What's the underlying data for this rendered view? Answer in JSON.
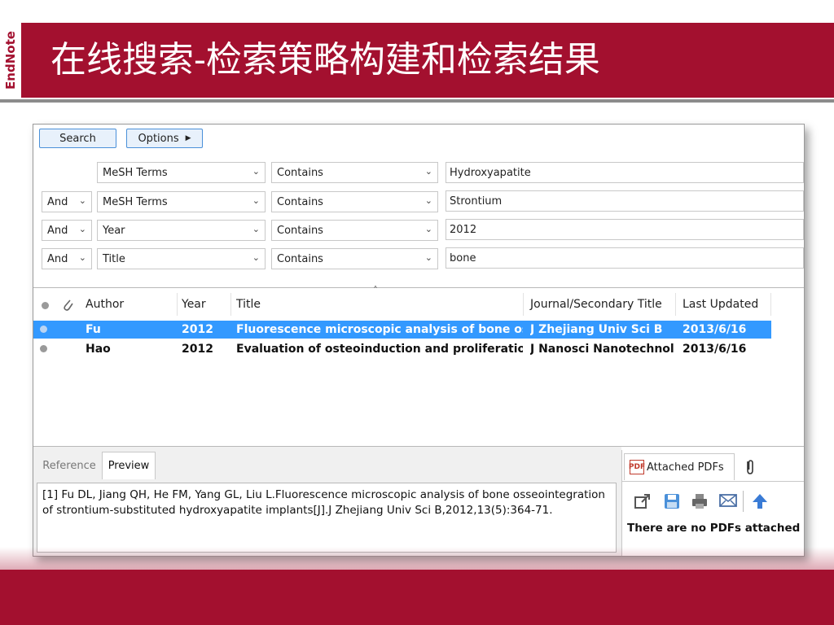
{
  "slide": {
    "logo": "EndNote",
    "title": "在线搜索-检索策略构建和检索结果"
  },
  "toolbar": {
    "search_label": "Search",
    "options_label": "Options",
    "options_arrow": "▶"
  },
  "search_rows": [
    {
      "bool": "",
      "field": "MeSH Terms",
      "operator": "Contains",
      "value": "Hydroxyapatite"
    },
    {
      "bool": "And",
      "field": "MeSH Terms",
      "operator": "Contains",
      "value": "Strontium"
    },
    {
      "bool": "And",
      "field": "Year",
      "operator": "Contains",
      "value": "2012"
    },
    {
      "bool": "And",
      "field": "Title",
      "operator": "Contains",
      "value": "bone"
    }
  ],
  "columns": {
    "author": "Author",
    "year": "Year",
    "title": "Title",
    "journal": "Journal/Secondary Title",
    "updated": "Last Updated",
    "sort_arrow": "˄"
  },
  "results": [
    {
      "author": "Fu",
      "year": "2012",
      "title": "Fluorescence microscopic analysis of bone osse...",
      "journal": "J Zhejiang Univ Sci B",
      "updated": "2013/6/16",
      "selected": true
    },
    {
      "author": "Hao",
      "year": "2012",
      "title": "Evaluation of osteoinduction and proliferation ...",
      "journal": "J Nanosci Nanotechnol",
      "updated": "2013/6/16",
      "selected": false
    }
  ],
  "panel_tabs": {
    "reference": "Reference",
    "preview": "Preview",
    "attached_pdfs": "Attached PDFs"
  },
  "preview_text": "[1] Fu DL, Jiang QH, He FM, Yang GL, Liu L.Fluorescence microscopic analysis of bone osseointegration of strontium-substituted hydroxyapatite implants[J].J Zhejiang Univ Sci B,2012,13(5):364-71.",
  "pdf_panel": {
    "empty_message": "There are no PDFs attached to"
  },
  "colors": {
    "brand_red": "#a3102f",
    "selection_blue": "#3399ff",
    "button_border": "#4a90d9"
  },
  "icons": [
    "open-link-icon",
    "save-icon",
    "print-icon",
    "email-icon",
    "up-arrow-icon",
    "paperclip-icon",
    "pdf-icon",
    "chevron-down-icon"
  ]
}
